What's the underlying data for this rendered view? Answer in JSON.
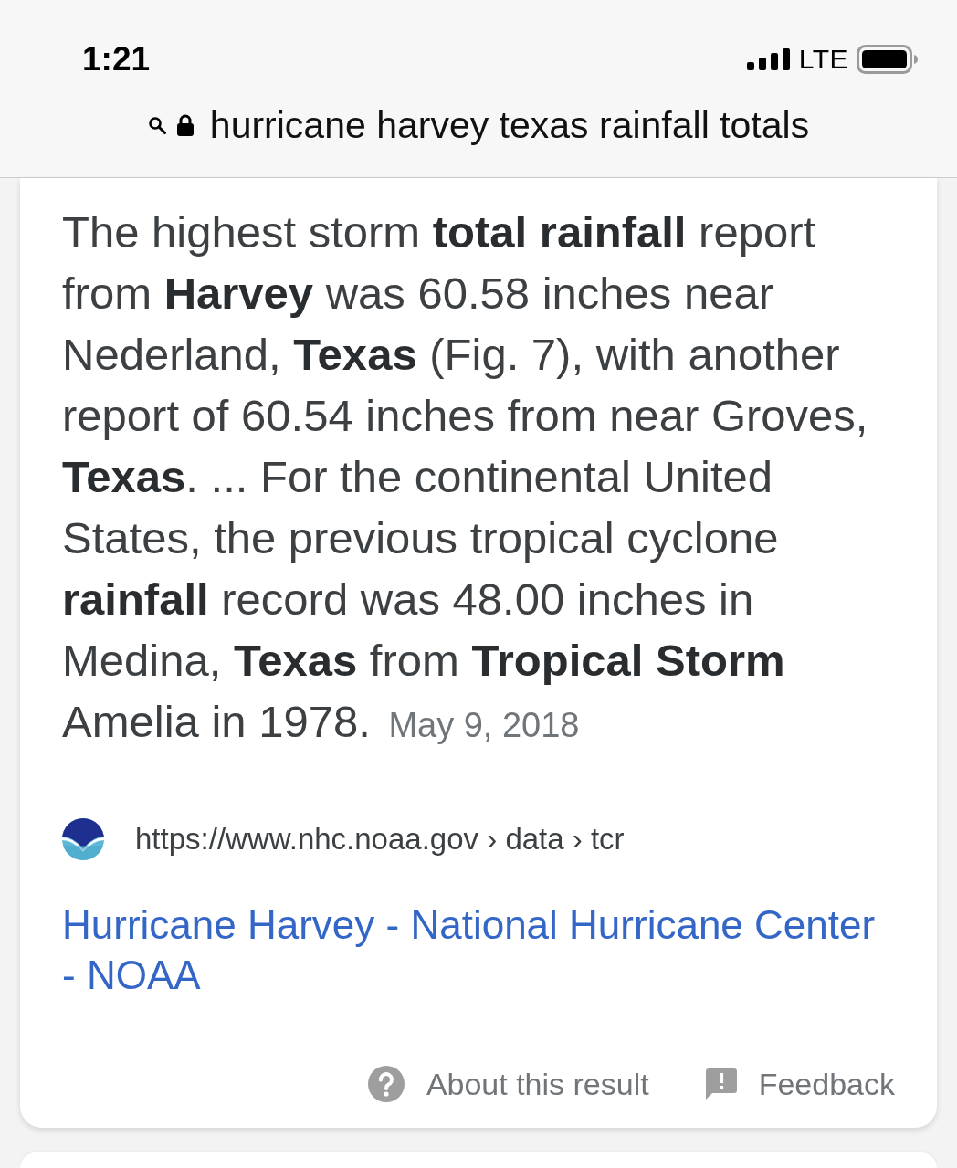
{
  "status_bar": {
    "time": "1:21",
    "network": "LTE"
  },
  "address_bar": {
    "query": "hurricane harvey texas rainfall totals"
  },
  "result": {
    "snippet": "The highest storm **total rainfall** report from **Harvey** was 60.58 inches near Nederland, **Texas** (Fig. 7), with another report of 60.54 inches from near Groves, **Texas**. ... For the continental United States, the previous tropical cyclone **rainfall** record was 48.00 inches in Medina, **Texas** from **Tropical Storm** Amelia in 1978.",
    "date": "May 9, 2018",
    "url": "https://www.nhc.noaa.gov › data › tcr",
    "title": "Hurricane Harvey - National Hurricane Center - NOAA",
    "footer": [
      {
        "kind": "about",
        "label": "About this result"
      },
      {
        "kind": "feedback",
        "label": "Feedback"
      }
    ]
  }
}
